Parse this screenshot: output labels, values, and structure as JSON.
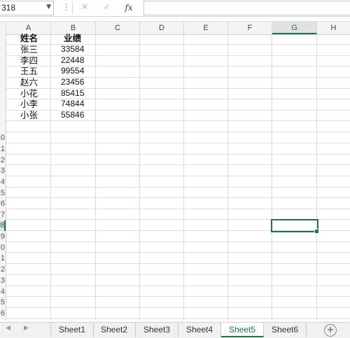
{
  "formula_bar": {
    "name_box": "318",
    "fx_label": "fx",
    "cancel_icon": "✕",
    "enter_icon": "✓",
    "formula_value": ""
  },
  "columns": [
    "A",
    "B",
    "C",
    "D",
    "E",
    "F",
    "G",
    "H"
  ],
  "selected_column": "G",
  "rows": [
    "0",
    "1",
    "2",
    "3",
    "4",
    "5",
    "6",
    "7",
    "8",
    "9",
    "0",
    "1",
    "2",
    "3",
    "4",
    "5",
    "6"
  ],
  "selected_row_label": "8",
  "table": {
    "headers": [
      "姓名",
      "业绩"
    ],
    "rows": [
      [
        "张三",
        "33584"
      ],
      [
        "李四",
        "22448"
      ],
      [
        "王五",
        "99554"
      ],
      [
        "赵六",
        "23456"
      ],
      [
        "小花",
        "85415"
      ],
      [
        "小李",
        "74844"
      ],
      [
        "小张",
        "55846"
      ]
    ]
  },
  "sheets": [
    "Sheet1",
    "Sheet2",
    "Sheet3",
    "Sheet4",
    "Sheet5",
    "Sheet6"
  ],
  "active_sheet": "Sheet5",
  "colors": {
    "accent": "#217346"
  }
}
